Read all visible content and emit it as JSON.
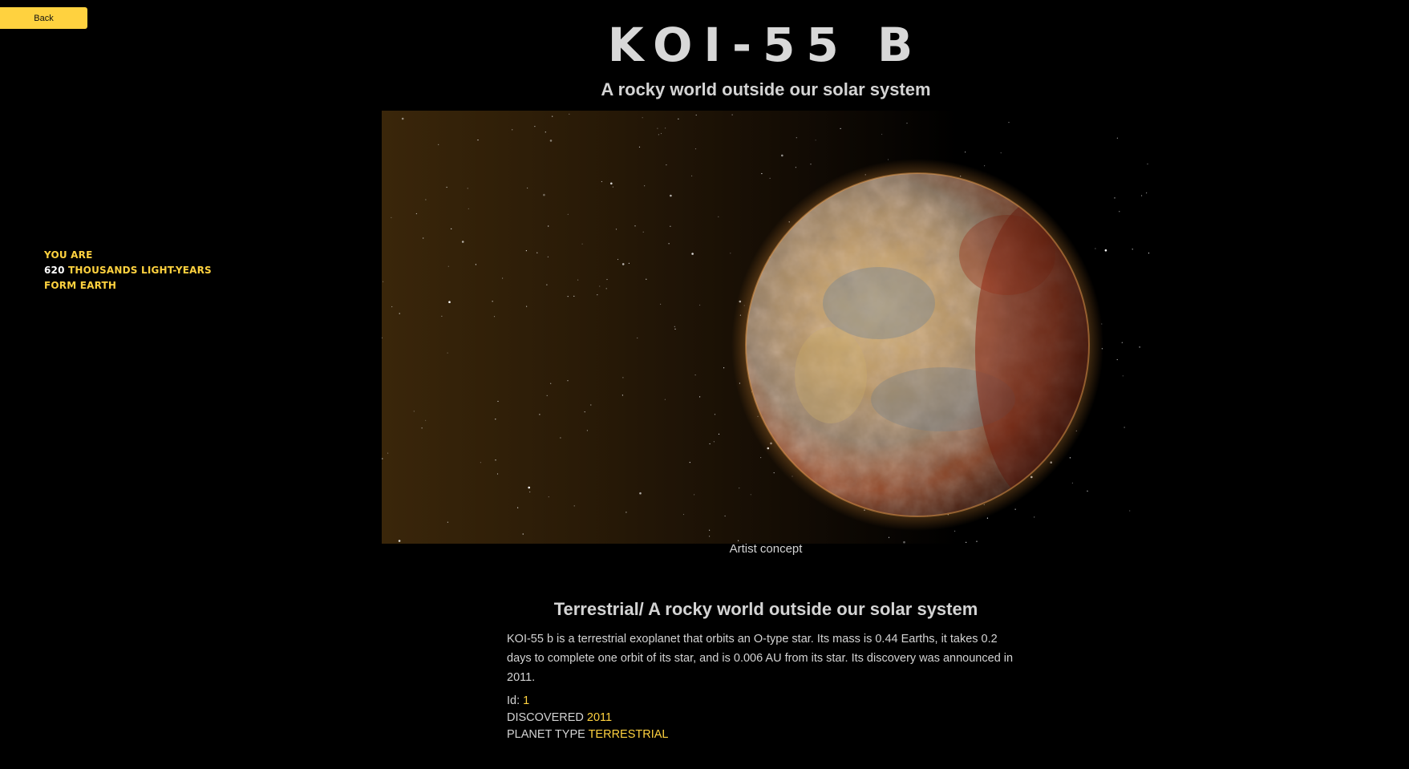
{
  "back_button": {
    "label": "Back"
  },
  "distance": {
    "line1": "YOU ARE",
    "value": "620",
    "unit": "THOUSANDS LIGHT-YEARS",
    "line3": "FORM EARTH"
  },
  "planet": {
    "name": "KOI-55 B",
    "subtitle": "A rocky world outside our solar system",
    "image_caption": "Artist concept",
    "section_title": "Terrestrial/ A rocky world outside our solar system",
    "description": "KOI-55 b is a terrestrial exoplanet that orbits an O-type star. Its mass is 0.44 Earths, it takes 0.2 days to complete one orbit of its star, and is 0.006 AU from its star. Its discovery was announced in 2011.",
    "id_label": "Id:",
    "id_value": "1",
    "discovered_label": "DISCOVERED",
    "discovered_value": "2011",
    "type_label": "PLANET TYPE",
    "type_value": "TERRESTRIAL"
  },
  "colors": {
    "accent": "#ffd23f",
    "background": "#000000",
    "text": "#d4d4d4"
  }
}
